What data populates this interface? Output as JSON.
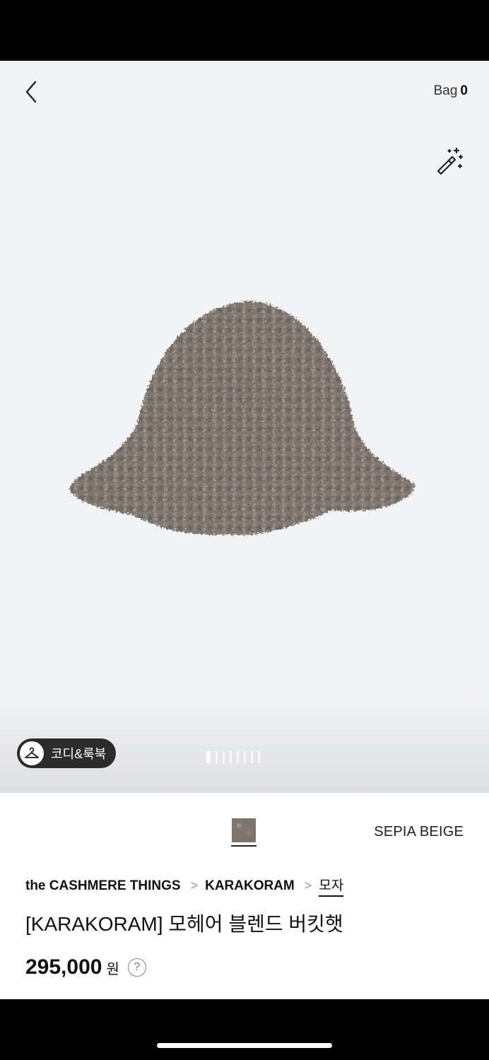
{
  "header": {
    "bag_label": "Bag",
    "bag_count": "0"
  },
  "gallery": {
    "coordi_label": "코디&룩북",
    "page_count": 8,
    "active_page": 1
  },
  "product": {
    "color_name": "SEPIA BEIGE",
    "breadcrumb": [
      "the CASHMERE THINGS",
      "KARAKORAM",
      "모자"
    ],
    "title": "[KARAKORAM] 모헤어 블렌드 버킷햇",
    "price": "295,000",
    "currency": "원",
    "help_symbol": "?"
  },
  "colors": {
    "hero_bg": "#f2f3f5",
    "hat": "#7d756e",
    "text": "#111111"
  }
}
